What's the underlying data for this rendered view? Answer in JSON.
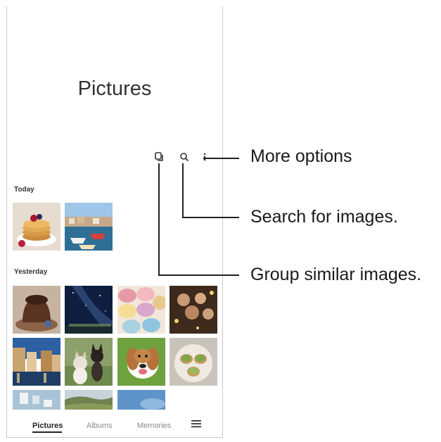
{
  "header": {
    "title": "Pictures"
  },
  "toolbar": {
    "icons": [
      "group-similar-icon",
      "search-icon",
      "more-options-icon"
    ]
  },
  "sections": {
    "today": {
      "label": "Today"
    },
    "yesterday": {
      "label": "Yesterday"
    }
  },
  "bottom_nav": {
    "tabs": [
      {
        "label": "Pictures",
        "active": true
      },
      {
        "label": "Albums",
        "active": false
      },
      {
        "label": "Memories",
        "active": false
      }
    ],
    "menu_icon": "menu-icon"
  },
  "callouts": {
    "more_options": "More options",
    "search": "Search for images.",
    "group": "Group similar images."
  },
  "colors": {
    "accent_text": "#222222",
    "inactive_text": "#8a8a8a"
  }
}
